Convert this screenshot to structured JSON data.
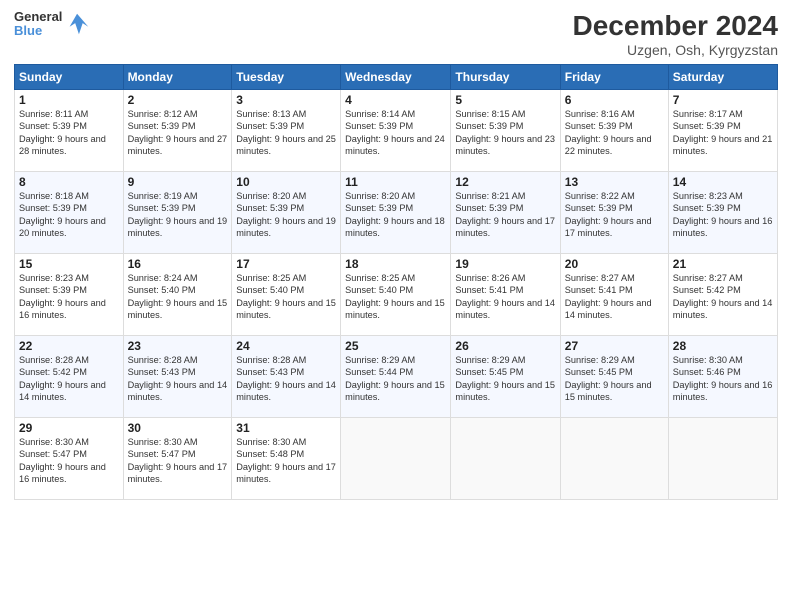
{
  "header": {
    "logo_line1": "General",
    "logo_line2": "Blue",
    "title": "December 2024",
    "subtitle": "Uzgen, Osh, Kyrgyzstan"
  },
  "weekdays": [
    "Sunday",
    "Monday",
    "Tuesday",
    "Wednesday",
    "Thursday",
    "Friday",
    "Saturday"
  ],
  "weeks": [
    [
      {
        "day": "1",
        "text": "Sunrise: 8:11 AM\nSunset: 5:39 PM\nDaylight: 9 hours and 28 minutes."
      },
      {
        "day": "2",
        "text": "Sunrise: 8:12 AM\nSunset: 5:39 PM\nDaylight: 9 hours and 27 minutes."
      },
      {
        "day": "3",
        "text": "Sunrise: 8:13 AM\nSunset: 5:39 PM\nDaylight: 9 hours and 25 minutes."
      },
      {
        "day": "4",
        "text": "Sunrise: 8:14 AM\nSunset: 5:39 PM\nDaylight: 9 hours and 24 minutes."
      },
      {
        "day": "5",
        "text": "Sunrise: 8:15 AM\nSunset: 5:39 PM\nDaylight: 9 hours and 23 minutes."
      },
      {
        "day": "6",
        "text": "Sunrise: 8:16 AM\nSunset: 5:39 PM\nDaylight: 9 hours and 22 minutes."
      },
      {
        "day": "7",
        "text": "Sunrise: 8:17 AM\nSunset: 5:39 PM\nDaylight: 9 hours and 21 minutes."
      }
    ],
    [
      {
        "day": "8",
        "text": "Sunrise: 8:18 AM\nSunset: 5:39 PM\nDaylight: 9 hours and 20 minutes."
      },
      {
        "day": "9",
        "text": "Sunrise: 8:19 AM\nSunset: 5:39 PM\nDaylight: 9 hours and 19 minutes."
      },
      {
        "day": "10",
        "text": "Sunrise: 8:20 AM\nSunset: 5:39 PM\nDaylight: 9 hours and 19 minutes."
      },
      {
        "day": "11",
        "text": "Sunrise: 8:20 AM\nSunset: 5:39 PM\nDaylight: 9 hours and 18 minutes."
      },
      {
        "day": "12",
        "text": "Sunrise: 8:21 AM\nSunset: 5:39 PM\nDaylight: 9 hours and 17 minutes."
      },
      {
        "day": "13",
        "text": "Sunrise: 8:22 AM\nSunset: 5:39 PM\nDaylight: 9 hours and 17 minutes."
      },
      {
        "day": "14",
        "text": "Sunrise: 8:23 AM\nSunset: 5:39 PM\nDaylight: 9 hours and 16 minutes."
      }
    ],
    [
      {
        "day": "15",
        "text": "Sunrise: 8:23 AM\nSunset: 5:39 PM\nDaylight: 9 hours and 16 minutes."
      },
      {
        "day": "16",
        "text": "Sunrise: 8:24 AM\nSunset: 5:40 PM\nDaylight: 9 hours and 15 minutes."
      },
      {
        "day": "17",
        "text": "Sunrise: 8:25 AM\nSunset: 5:40 PM\nDaylight: 9 hours and 15 minutes."
      },
      {
        "day": "18",
        "text": "Sunrise: 8:25 AM\nSunset: 5:40 PM\nDaylight: 9 hours and 15 minutes."
      },
      {
        "day": "19",
        "text": "Sunrise: 8:26 AM\nSunset: 5:41 PM\nDaylight: 9 hours and 14 minutes."
      },
      {
        "day": "20",
        "text": "Sunrise: 8:27 AM\nSunset: 5:41 PM\nDaylight: 9 hours and 14 minutes."
      },
      {
        "day": "21",
        "text": "Sunrise: 8:27 AM\nSunset: 5:42 PM\nDaylight: 9 hours and 14 minutes."
      }
    ],
    [
      {
        "day": "22",
        "text": "Sunrise: 8:28 AM\nSunset: 5:42 PM\nDaylight: 9 hours and 14 minutes."
      },
      {
        "day": "23",
        "text": "Sunrise: 8:28 AM\nSunset: 5:43 PM\nDaylight: 9 hours and 14 minutes."
      },
      {
        "day": "24",
        "text": "Sunrise: 8:28 AM\nSunset: 5:43 PM\nDaylight: 9 hours and 14 minutes."
      },
      {
        "day": "25",
        "text": "Sunrise: 8:29 AM\nSunset: 5:44 PM\nDaylight: 9 hours and 15 minutes."
      },
      {
        "day": "26",
        "text": "Sunrise: 8:29 AM\nSunset: 5:45 PM\nDaylight: 9 hours and 15 minutes."
      },
      {
        "day": "27",
        "text": "Sunrise: 8:29 AM\nSunset: 5:45 PM\nDaylight: 9 hours and 15 minutes."
      },
      {
        "day": "28",
        "text": "Sunrise: 8:30 AM\nSunset: 5:46 PM\nDaylight: 9 hours and 16 minutes."
      }
    ],
    [
      {
        "day": "29",
        "text": "Sunrise: 8:30 AM\nSunset: 5:47 PM\nDaylight: 9 hours and 16 minutes."
      },
      {
        "day": "30",
        "text": "Sunrise: 8:30 AM\nSunset: 5:47 PM\nDaylight: 9 hours and 17 minutes."
      },
      {
        "day": "31",
        "text": "Sunrise: 8:30 AM\nSunset: 5:48 PM\nDaylight: 9 hours and 17 minutes."
      },
      null,
      null,
      null,
      null
    ]
  ]
}
